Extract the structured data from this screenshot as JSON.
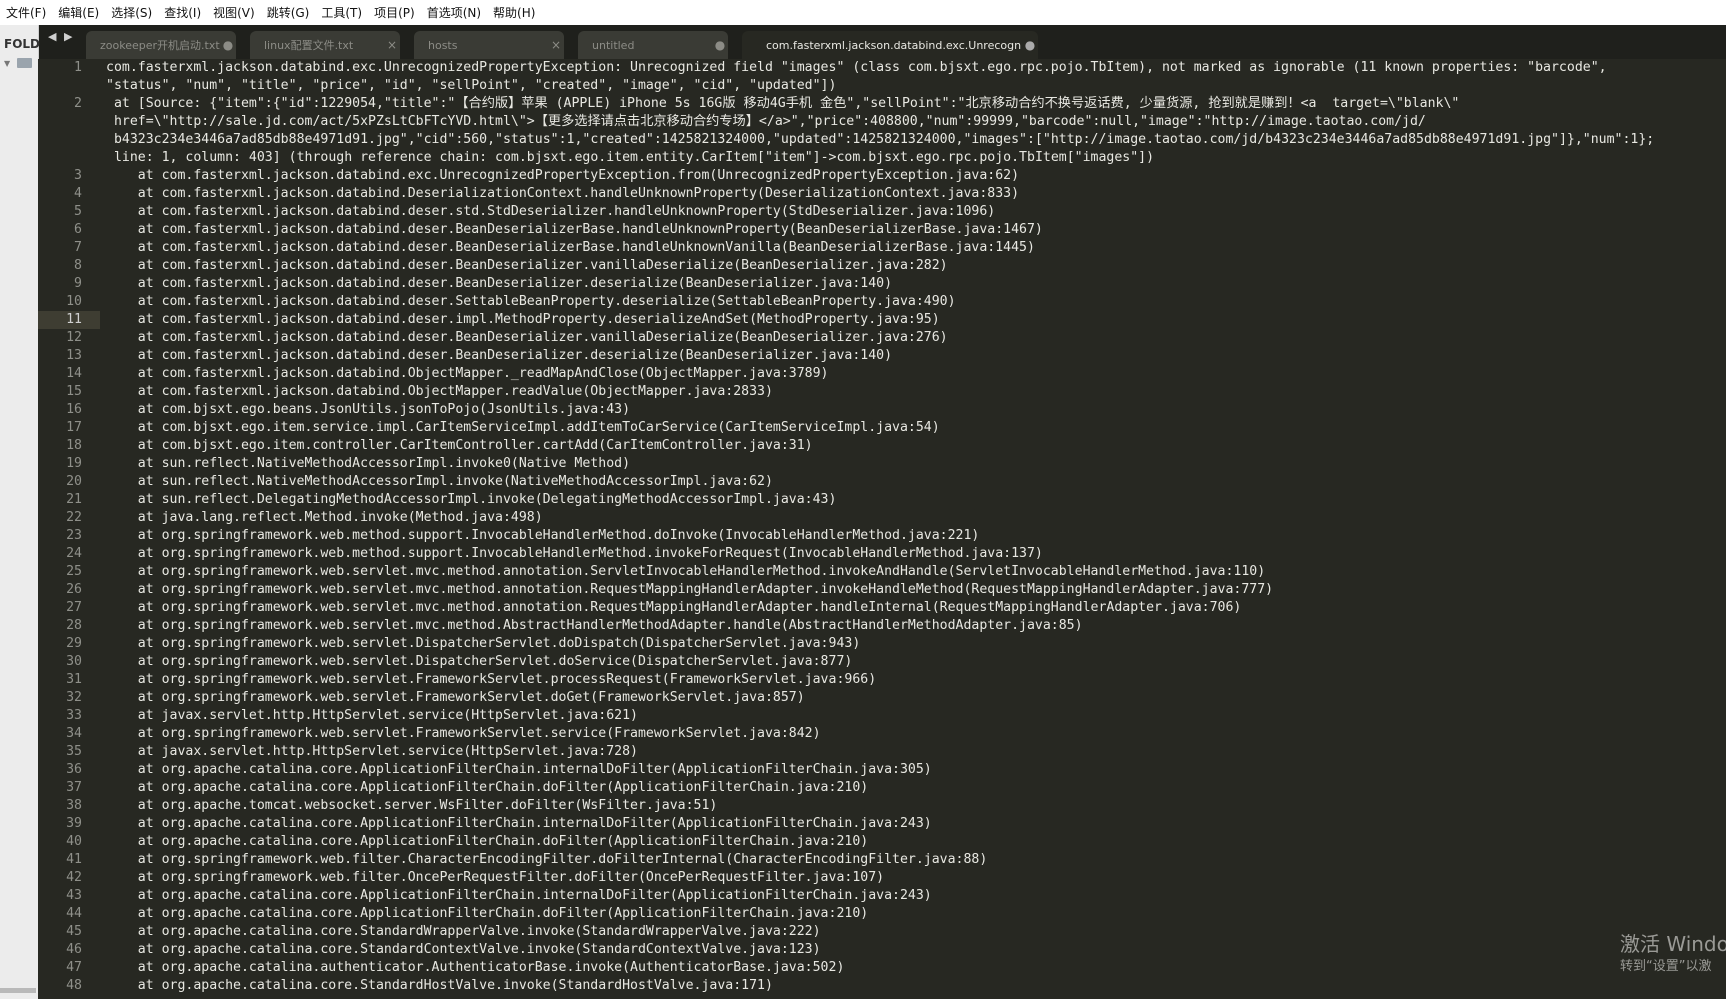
{
  "menu": [
    "文件(F)",
    "编辑(E)",
    "选择(S)",
    "查找(I)",
    "视图(V)",
    "跳转(G)",
    "工具(T)",
    "项目(P)",
    "首选项(N)",
    "帮助(H)"
  ],
  "sidebar": {
    "label": "FOLD"
  },
  "nav": {
    "back": "◀",
    "forward": "▶"
  },
  "tabs": [
    {
      "label": "zookeeper开机启动.txt",
      "state": "dot"
    },
    {
      "label": "linux配置文件.txt",
      "state": "close"
    },
    {
      "label": "hosts",
      "state": "close"
    },
    {
      "label": "untitled",
      "state": "dot"
    },
    {
      "label": "com.fasterxml.jackson.databind.exc.UnrecognizedPro",
      "state": "dot",
      "active": true
    }
  ],
  "tab_symbols": {
    "dot": "●",
    "close": "×"
  },
  "current_line": 11,
  "lines": [
    {
      "n": "1",
      "text": "com.fasterxml.jackson.databind.exc.UnrecognizedPropertyException: Unrecognized field \"images\" (class com.bjsxt.ego.rpc.pojo.TbItem), not marked as ignorable (11 known properties: \"barcode\",\n\"status\", \"num\", \"title\", \"price\", \"id\", \"sellPoint\", \"created\", \"image\", \"cid\", \"updated\"])"
    },
    {
      "n": "2",
      "text": " at [Source: {\"item\":{\"id\":1229054,\"title\":\"【合约版】苹果 (APPLE) iPhone 5s 16G版 移动4G手机 金色\",\"sellPoint\":\"北京移动合约不换号返话费, 少量货源, 抢到就是赚到！<a  target=\\\"blank\\\"\n href=\\\"http://sale.jd.com/act/5xPZsLtCbFTcYVD.html\\\">【更多选择请点击北京移动合约专场】</a>\",\"price\":408800,\"num\":99999,\"barcode\":null,\"image\":\"http://image.taotao.com/jd/\n b4323c234e3446a7ad85db88e4971d91.jpg\",\"cid\":560,\"status\":1,\"created\":1425821324000,\"updated\":1425821324000,\"images\":[\"http://image.taotao.com/jd/b4323c234e3446a7ad85db88e4971d91.jpg\"]},\"num\":1};\n line: 1, column: 403] (through reference chain: com.bjsxt.ego.item.entity.CarItem[\"item\"]->com.bjsxt.ego.rpc.pojo.TbItem[\"images\"])"
    },
    {
      "n": "3",
      "text": "    at com.fasterxml.jackson.databind.exc.UnrecognizedPropertyException.from(UnrecognizedPropertyException.java:62)"
    },
    {
      "n": "4",
      "text": "    at com.fasterxml.jackson.databind.DeserializationContext.handleUnknownProperty(DeserializationContext.java:833)"
    },
    {
      "n": "5",
      "text": "    at com.fasterxml.jackson.databind.deser.std.StdDeserializer.handleUnknownProperty(StdDeserializer.java:1096)"
    },
    {
      "n": "6",
      "text": "    at com.fasterxml.jackson.databind.deser.BeanDeserializerBase.handleUnknownProperty(BeanDeserializerBase.java:1467)"
    },
    {
      "n": "7",
      "text": "    at com.fasterxml.jackson.databind.deser.BeanDeserializerBase.handleUnknownVanilla(BeanDeserializerBase.java:1445)"
    },
    {
      "n": "8",
      "text": "    at com.fasterxml.jackson.databind.deser.BeanDeserializer.vanillaDeserialize(BeanDeserializer.java:282)"
    },
    {
      "n": "9",
      "text": "    at com.fasterxml.jackson.databind.deser.BeanDeserializer.deserialize(BeanDeserializer.java:140)"
    },
    {
      "n": "10",
      "text": "    at com.fasterxml.jackson.databind.deser.SettableBeanProperty.deserialize(SettableBeanProperty.java:490)"
    },
    {
      "n": "11",
      "text": "    at com.fasterxml.jackson.databind.deser.impl.MethodProperty.deserializeAndSet(MethodProperty.java:95)"
    },
    {
      "n": "12",
      "text": "    at com.fasterxml.jackson.databind.deser.BeanDeserializer.vanillaDeserialize(BeanDeserializer.java:276)"
    },
    {
      "n": "13",
      "text": "    at com.fasterxml.jackson.databind.deser.BeanDeserializer.deserialize(BeanDeserializer.java:140)"
    },
    {
      "n": "14",
      "text": "    at com.fasterxml.jackson.databind.ObjectMapper._readMapAndClose(ObjectMapper.java:3789)"
    },
    {
      "n": "15",
      "text": "    at com.fasterxml.jackson.databind.ObjectMapper.readValue(ObjectMapper.java:2833)"
    },
    {
      "n": "16",
      "text": "    at com.bjsxt.ego.beans.JsonUtils.jsonToPojo(JsonUtils.java:43)"
    },
    {
      "n": "17",
      "text": "    at com.bjsxt.ego.item.service.impl.CarItemServiceImpl.addItemToCarService(CarItemServiceImpl.java:54)"
    },
    {
      "n": "18",
      "text": "    at com.bjsxt.ego.item.controller.CarItemController.cartAdd(CarItemController.java:31)"
    },
    {
      "n": "19",
      "text": "    at sun.reflect.NativeMethodAccessorImpl.invoke0(Native Method)"
    },
    {
      "n": "20",
      "text": "    at sun.reflect.NativeMethodAccessorImpl.invoke(NativeMethodAccessorImpl.java:62)"
    },
    {
      "n": "21",
      "text": "    at sun.reflect.DelegatingMethodAccessorImpl.invoke(DelegatingMethodAccessorImpl.java:43)"
    },
    {
      "n": "22",
      "text": "    at java.lang.reflect.Method.invoke(Method.java:498)"
    },
    {
      "n": "23",
      "text": "    at org.springframework.web.method.support.InvocableHandlerMethod.doInvoke(InvocableHandlerMethod.java:221)"
    },
    {
      "n": "24",
      "text": "    at org.springframework.web.method.support.InvocableHandlerMethod.invokeForRequest(InvocableHandlerMethod.java:137)"
    },
    {
      "n": "25",
      "text": "    at org.springframework.web.servlet.mvc.method.annotation.ServletInvocableHandlerMethod.invokeAndHandle(ServletInvocableHandlerMethod.java:110)"
    },
    {
      "n": "26",
      "text": "    at org.springframework.web.servlet.mvc.method.annotation.RequestMappingHandlerAdapter.invokeHandleMethod(RequestMappingHandlerAdapter.java:777)"
    },
    {
      "n": "27",
      "text": "    at org.springframework.web.servlet.mvc.method.annotation.RequestMappingHandlerAdapter.handleInternal(RequestMappingHandlerAdapter.java:706)"
    },
    {
      "n": "28",
      "text": "    at org.springframework.web.servlet.mvc.method.AbstractHandlerMethodAdapter.handle(AbstractHandlerMethodAdapter.java:85)"
    },
    {
      "n": "29",
      "text": "    at org.springframework.web.servlet.DispatcherServlet.doDispatch(DispatcherServlet.java:943)"
    },
    {
      "n": "30",
      "text": "    at org.springframework.web.servlet.DispatcherServlet.doService(DispatcherServlet.java:877)"
    },
    {
      "n": "31",
      "text": "    at org.springframework.web.servlet.FrameworkServlet.processRequest(FrameworkServlet.java:966)"
    },
    {
      "n": "32",
      "text": "    at org.springframework.web.servlet.FrameworkServlet.doGet(FrameworkServlet.java:857)"
    },
    {
      "n": "33",
      "text": "    at javax.servlet.http.HttpServlet.service(HttpServlet.java:621)"
    },
    {
      "n": "34",
      "text": "    at org.springframework.web.servlet.FrameworkServlet.service(FrameworkServlet.java:842)"
    },
    {
      "n": "35",
      "text": "    at javax.servlet.http.HttpServlet.service(HttpServlet.java:728)"
    },
    {
      "n": "36",
      "text": "    at org.apache.catalina.core.ApplicationFilterChain.internalDoFilter(ApplicationFilterChain.java:305)"
    },
    {
      "n": "37",
      "text": "    at org.apache.catalina.core.ApplicationFilterChain.doFilter(ApplicationFilterChain.java:210)"
    },
    {
      "n": "38",
      "text": "    at org.apache.tomcat.websocket.server.WsFilter.doFilter(WsFilter.java:51)"
    },
    {
      "n": "39",
      "text": "    at org.apache.catalina.core.ApplicationFilterChain.internalDoFilter(ApplicationFilterChain.java:243)"
    },
    {
      "n": "40",
      "text": "    at org.apache.catalina.core.ApplicationFilterChain.doFilter(ApplicationFilterChain.java:210)"
    },
    {
      "n": "41",
      "text": "    at org.springframework.web.filter.CharacterEncodingFilter.doFilterInternal(CharacterEncodingFilter.java:88)"
    },
    {
      "n": "42",
      "text": "    at org.springframework.web.filter.OncePerRequestFilter.doFilter(OncePerRequestFilter.java:107)"
    },
    {
      "n": "43",
      "text": "    at org.apache.catalina.core.ApplicationFilterChain.internalDoFilter(ApplicationFilterChain.java:243)"
    },
    {
      "n": "44",
      "text": "    at org.apache.catalina.core.ApplicationFilterChain.doFilter(ApplicationFilterChain.java:210)"
    },
    {
      "n": "45",
      "text": "    at org.apache.catalina.core.StandardWrapperValve.invoke(StandardWrapperValve.java:222)"
    },
    {
      "n": "46",
      "text": "    at org.apache.catalina.core.StandardContextValve.invoke(StandardContextValve.java:123)"
    },
    {
      "n": "47",
      "text": "    at org.apache.catalina.authenticator.AuthenticatorBase.invoke(AuthenticatorBase.java:502)"
    },
    {
      "n": "48",
      "text": "    at org.apache.catalina.core.StandardHostValve.invoke(StandardHostValve.java:171)"
    }
  ],
  "watermark": {
    "line1": "激活 Windo",
    "line2": "转到“设置”以激"
  },
  "colors": {
    "editor_bg": "#272822",
    "text": "#e8e8e2",
    "gutter_text": "#8f908a"
  }
}
